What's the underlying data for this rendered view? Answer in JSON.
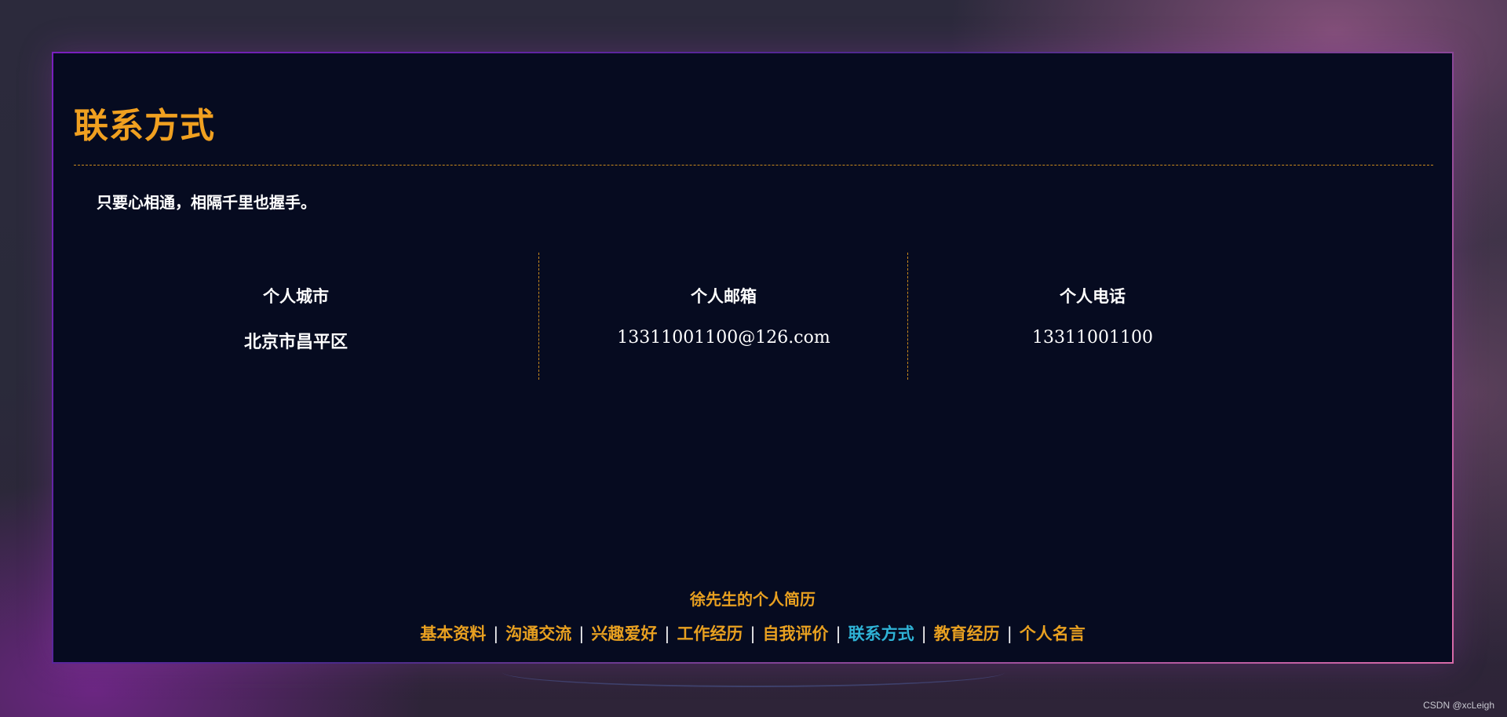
{
  "section": {
    "title": "联系方式",
    "motto": "只要心相通，相隔千里也握手。"
  },
  "contacts": [
    {
      "label": "个人城市",
      "value": "北京市昌平区"
    },
    {
      "label": "个人邮箱",
      "value": "13311001100@126.com"
    },
    {
      "label": "个人电话",
      "value": "13311001100"
    }
  ],
  "footer": {
    "name": "徐先生的个人简历",
    "nav": [
      {
        "label": "基本资料"
      },
      {
        "label": "沟通交流"
      },
      {
        "label": "兴趣爱好"
      },
      {
        "label": "工作经历"
      },
      {
        "label": "自我评价"
      },
      {
        "label": "联系方式",
        "active": true
      },
      {
        "label": "教育经历"
      },
      {
        "label": "个人名言"
      }
    ],
    "separator": "|"
  },
  "watermark": "CSDN @xcLeigh",
  "colors": {
    "accent": "#f0a020",
    "active_link": "#2fb3d6",
    "panel_bg": "#060b20",
    "text": "#ffffff"
  }
}
